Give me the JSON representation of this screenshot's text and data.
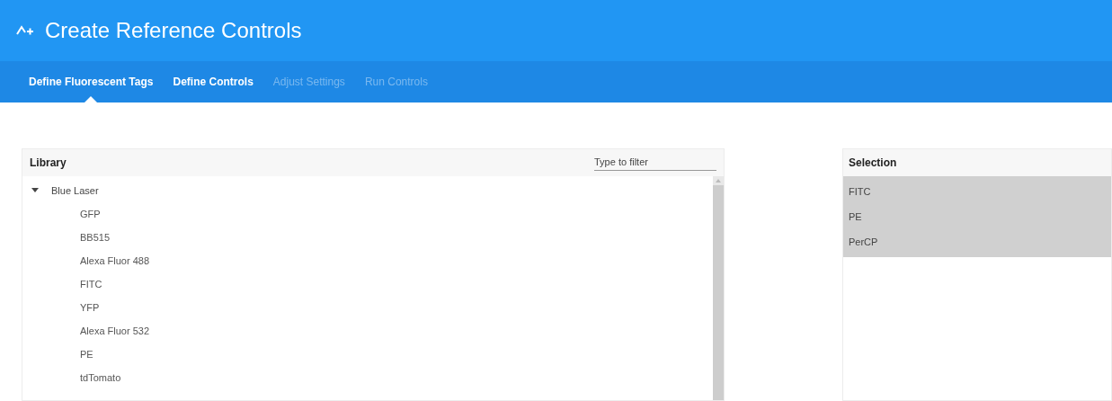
{
  "window": {
    "title": "Create Reference Controls"
  },
  "tabs": [
    {
      "label": "Define Fluorescent Tags",
      "selected": true,
      "disabled": false
    },
    {
      "label": "Define Controls",
      "selected": false,
      "disabled": false
    },
    {
      "label": "Adjust Settings",
      "selected": false,
      "disabled": true
    },
    {
      "label": "Run Controls",
      "selected": false,
      "disabled": true
    }
  ],
  "library": {
    "title": "Library",
    "filter": {
      "placeholder": "Type to filter"
    },
    "tree": [
      {
        "label": "Blue Laser",
        "expanded": true,
        "children": [
          {
            "label": "GFP"
          },
          {
            "label": "BB515"
          },
          {
            "label": "Alexa Fluor 488"
          },
          {
            "label": "FITC"
          },
          {
            "label": "YFP"
          },
          {
            "label": "Alexa Fluor 532"
          },
          {
            "label": "PE"
          },
          {
            "label": "tdTomato"
          }
        ]
      }
    ]
  },
  "selection": {
    "title": "Selection",
    "items": [
      "FITC",
      "PE",
      "PerCP"
    ]
  }
}
